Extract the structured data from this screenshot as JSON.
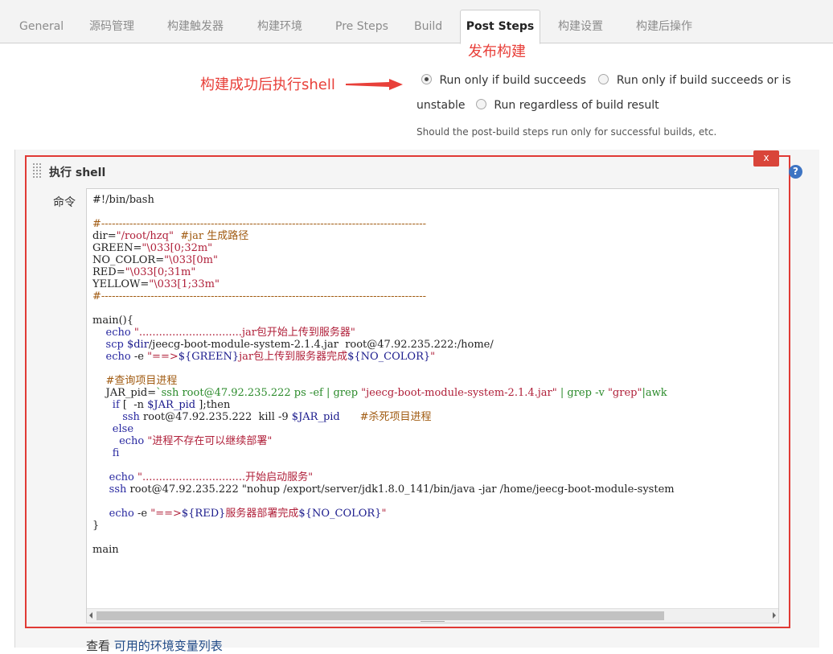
{
  "tabs": [
    {
      "label": "General"
    },
    {
      "label": "源码管理"
    },
    {
      "label": "构建触发器"
    },
    {
      "label": "构建环境"
    },
    {
      "label": "Pre Steps"
    },
    {
      "label": "Build"
    },
    {
      "label": "Post Steps",
      "active": true
    },
    {
      "label": "构建设置"
    },
    {
      "label": "构建后操作"
    }
  ],
  "annotations": {
    "top": "发布构建",
    "left": "构建成功后执行shell",
    "color": "#e8403a"
  },
  "post_steps": {
    "options": [
      {
        "label": "Run only if build succeeds",
        "checked": true
      },
      {
        "label": "Run only if build succeeds or is",
        "label_cont": "unstable",
        "checked": false
      },
      {
        "label": "Run regardless of build result",
        "checked": false
      }
    ],
    "hint": "Should the post-build steps run only for successful builds, etc."
  },
  "shell_step": {
    "title": "执行 shell",
    "close_label": "x",
    "help_label": "?",
    "command_label": "命令",
    "command_lines": [
      "#!/bin/bash",
      "",
      "#--------------------------------------------------------------------------------------------",
      "dir=\"/root/hzq\"  #jar 生成路径",
      "GREEN=\"\\033[0;32m\"",
      "NO_COLOR=\"\\033[0m\"",
      "RED=\"\\033[0;31m\"",
      "YELLOW=\"\\033[1;33m\"",
      "#--------------------------------------------------------------------------------------------",
      "",
      "main(){",
      "    echo \"...............................jar包开始上传到服务器\"",
      "    scp $dir/jeecg-boot-module-system-2.1.4.jar  root@47.92.235.222:/home/",
      "    echo -e \"==>${GREEN}jar包上传到服务器完成${NO_COLOR}\"",
      "",
      "    #查询项目进程",
      "    JAR_pid=`ssh root@47.92.235.222 ps -ef | grep \"jeecg-boot-module-system-2.1.4.jar\" | grep -v \"grep\"|awk",
      "      if [  -n $JAR_pid ];then",
      "         ssh root@47.92.235.222  kill -9 $JAR_pid      #杀死项目进程",
      "      else",
      "        echo \"进程不存在可以继续部署\"",
      "      fi",
      "",
      "     echo \"...............................开始启动服务\"",
      "     ssh root@47.92.235.222 \"nohup /export/server/jdk1.8.0_141/bin/java -jar /home/jeecg-boot-module-system",
      "",
      "     echo -e \"==>${RED}服务器部署完成${NO_COLOR}\"",
      "}",
      "",
      "main"
    ]
  },
  "footer": {
    "prefix": "查看 ",
    "link": "可用的环境变量列表"
  }
}
